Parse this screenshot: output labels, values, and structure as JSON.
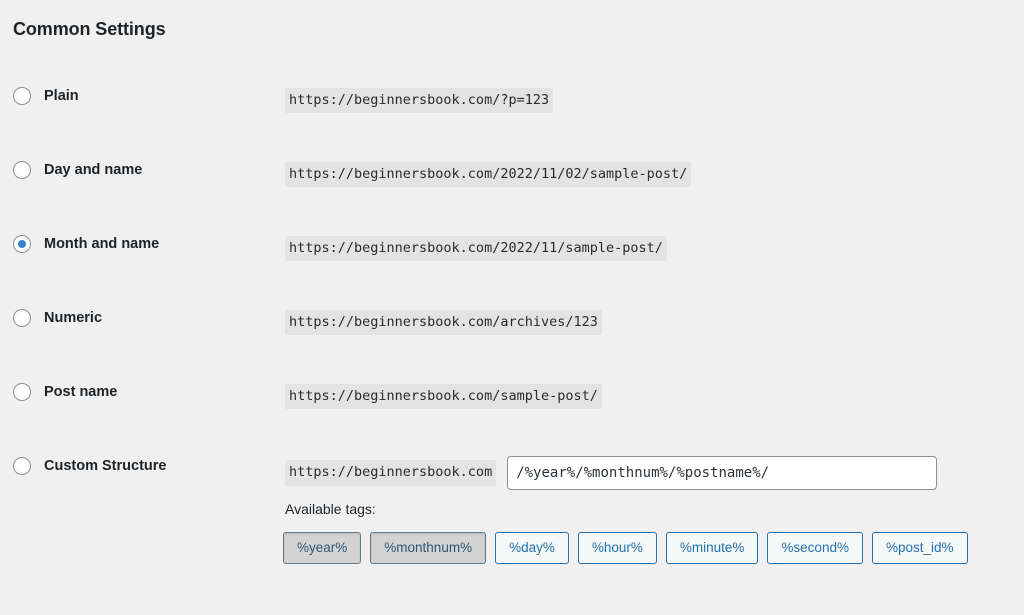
{
  "section": {
    "heading": "Common Settings"
  },
  "options": [
    {
      "id": "plain",
      "label": "Plain",
      "url": "https://beginnersbook.com/?p=123",
      "selected": false
    },
    {
      "id": "day-and-name",
      "label": "Day and name",
      "url": "https://beginnersbook.com/2022/11/02/sample-post/",
      "selected": false
    },
    {
      "id": "month-and-name",
      "label": "Month and name",
      "url": "https://beginnersbook.com/2022/11/sample-post/",
      "selected": true
    },
    {
      "id": "numeric",
      "label": "Numeric",
      "url": "https://beginnersbook.com/archives/123",
      "selected": false
    },
    {
      "id": "post-name",
      "label": "Post name",
      "url": "https://beginnersbook.com/sample-post/",
      "selected": false
    }
  ],
  "custom_structure": {
    "label": "Custom Structure",
    "site_prefix": "https://beginnersbook.com",
    "input_value": "/%year%/%monthnum%/%postname%/",
    "input_placeholder": "",
    "selected": false,
    "available_tags_label": "Available tags:",
    "tags": [
      {
        "label": "%year%",
        "pressed": true
      },
      {
        "label": "%monthnum%",
        "pressed": true
      },
      {
        "label": "%day%",
        "pressed": false
      },
      {
        "label": "%hour%",
        "pressed": false
      },
      {
        "label": "%minute%",
        "pressed": false
      },
      {
        "label": "%second%",
        "pressed": false
      },
      {
        "label": "%post_id%",
        "pressed": false
      }
    ]
  },
  "colors": {
    "page_background": "#f0f0f1",
    "code_background": "#e3e3e3",
    "accent_blue": "#2271b1",
    "radio_selected": "#3582c4",
    "text": "#1d2327"
  }
}
